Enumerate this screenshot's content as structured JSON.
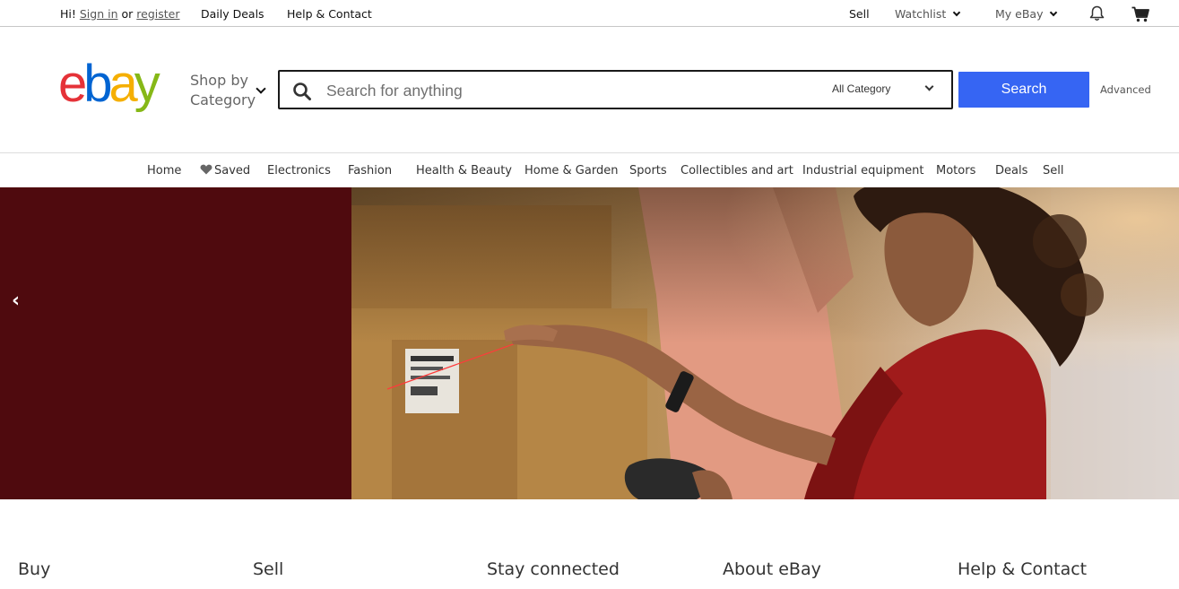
{
  "topbar": {
    "greeting": "Hi!",
    "sign_in": "Sign in",
    "or": "or",
    "register": "register",
    "daily_deals": "Daily Deals",
    "help_contact": "Help & Contact",
    "sell": "Sell",
    "watchlist": "Watchlist",
    "my_ebay": "My eBay",
    "notification_icon": "bell-icon",
    "cart_icon": "cart-icon"
  },
  "header": {
    "logo_text": "ebay",
    "shop_by_line1": "Shop by",
    "shop_by_line2": "Category",
    "search_placeholder": "Search for anything",
    "category_value": "All Category",
    "search_button": "Search",
    "advanced": "Advanced",
    "brand_colors": {
      "e": "#e53238",
      "b": "#0064d2",
      "a": "#f5af02",
      "y": "#86b817",
      "search_button": "#3665f3"
    }
  },
  "nav": {
    "items": [
      "Home",
      "Saved",
      "Electronics",
      "Fashion",
      "Health & Beauty",
      "Home & Garden",
      "Sports",
      "Collectibles and art",
      "Industrial equipment",
      "Motors",
      "Deals",
      "Sell"
    ]
  },
  "hero": {
    "prev_glyph": "‹",
    "panel_color": "#4f0a0e"
  },
  "footer": {
    "columns": [
      "Buy",
      "Sell",
      "Stay connected",
      "About eBay",
      "Help & Contact"
    ]
  }
}
